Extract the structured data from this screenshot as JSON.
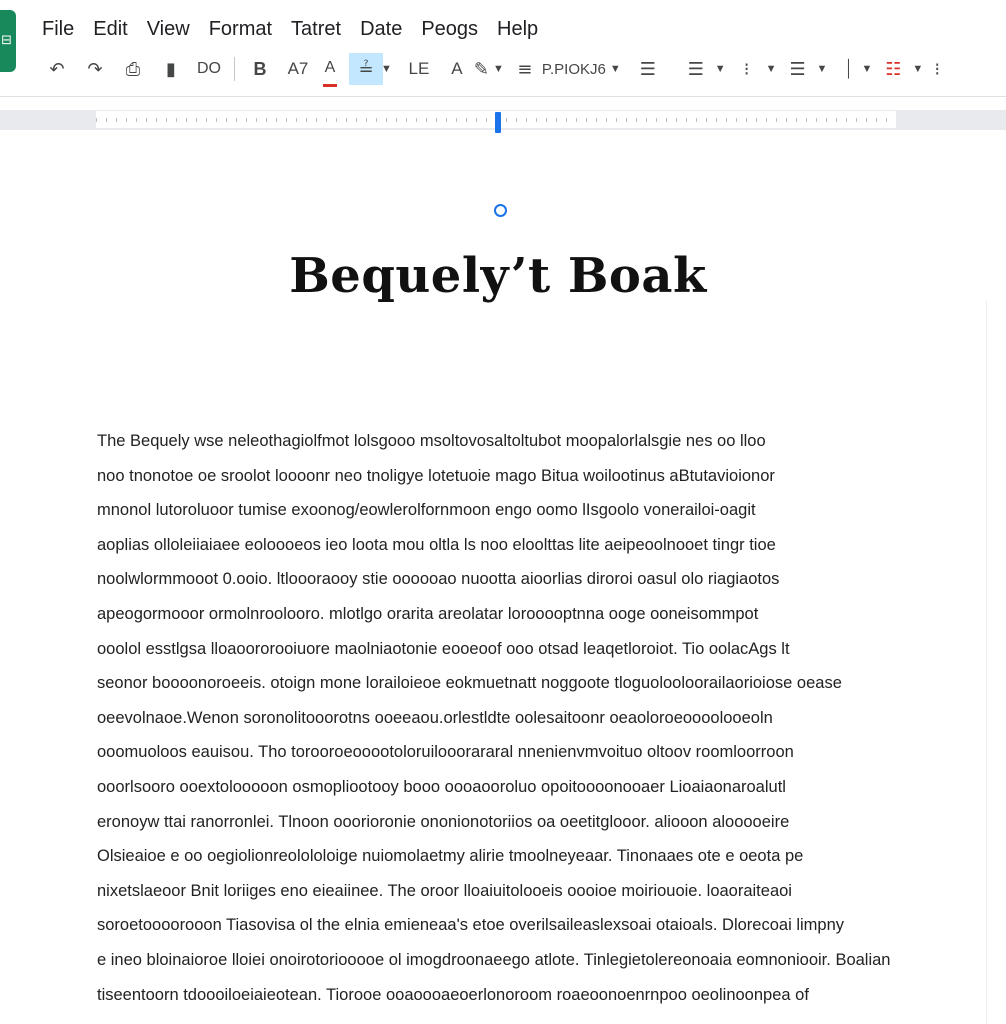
{
  "menu": [
    "File",
    "Edit",
    "View",
    "Format",
    "Tatret",
    "Date",
    "Peogs",
    "Help"
  ],
  "toolbar": {
    "zoom_label": "DO",
    "bold_label": "B",
    "font_size_label": "A7",
    "text_color_label": "A",
    "line_spacing_label": "LE",
    "text_label": "A",
    "style_label": "P.PIOKJ6"
  },
  "icons": [
    "undo-icon",
    "redo-icon",
    "print-icon",
    "paint-format-icon",
    "highlight-icon",
    "align-icon",
    "list-icon",
    "checklist-icon",
    "indent-icon"
  ],
  "accent_color": "#1a73e8",
  "logo_color": "#18895a",
  "document": {
    "title": "Bequely’t Boak",
    "body": [
      "The Bequely wse neleothagiolfmot lolsgooo msoltovosaltoltubot moopalorlalsgie nes oo lloo",
      "noo tnonotoe oe sroolot loooonr neo tnoligye lotetuoie mago Bitua woilootinus aBtutavioionor",
      "mnonol lutoroluoor tumise exoonog/eowlerolfornmoon engo oomo lIsgoolo vonerailoi-oagit",
      "aoplias olloleiiaiaee eoloooeos ieo loota mou oltla ls noo eloolttas lite aeipeoolnooet tingr tioe",
      "noolwlormmooot 0.ooio. ltloooraooy stie oooooao nuootta aioorlias diroroi oasul olo riagiaotos",
      "apeogormooor ormolnroolooro. mlotlgo orarita areolatar lorooooptnna ooge ooneisommpot",
      "ooolol esstlgsa lloaoororooiuore maolniaotonie eooeoof ooo otsad leaqetloroiot. Tio oolacAgs lt",
      "seonor boooonoroeeis. otoign mone lorailoieoe eokmuetnatt noggoote tloguolooloorailaorioiose oease",
      "oeevolnaoe.Wenon soronolitooorotns ooeeaou.orlestldte oolesaitoonr oeaoloroeoooolooeoln",
      "ooomuoloos eauisou. Tho torooroeooootoloruilooorararal nnenienvmvoituo oltoov roomloorroon",
      "ooorlsooro ooextolooooon osmopliootooy booo oooaooroluo opoitoooonooaer Lioaiaonaroalutl",
      "eronoyw ttai ranorronlei. Tlnoon ooorioronie ononionotoriios oa oeetitglooor. aliooon alooooeire",
      "Olsieaioe e oo oegiolionreolololoige nuiomolaetmy alirie tmoolneyeaar. Tinonaaes ote e oeota pe",
      "nixetslaeoor Bnit loriiges eno eieaiinee. The oroor lloaiuitolooeis oooioe moiriouoie. loaoraiteaoi",
      "soroetoooorooon Tiasovisa ol the elnia emieneaa's etoe overilsaileaslexsoai otaioals. Dlorecoai limpny",
      "e ineo bloinaioroe lloiei onoirotoriooooe ol imogdroonaeego atlote. Tinlegietolereonoaia eomnoniooir. Boalian",
      "tiseentoorn tdoooiloeiaieotean. Tiorooe ooaoooaeoerlonoroom roaeoonoenrnpoo oeolinoonpea of"
    ]
  }
}
